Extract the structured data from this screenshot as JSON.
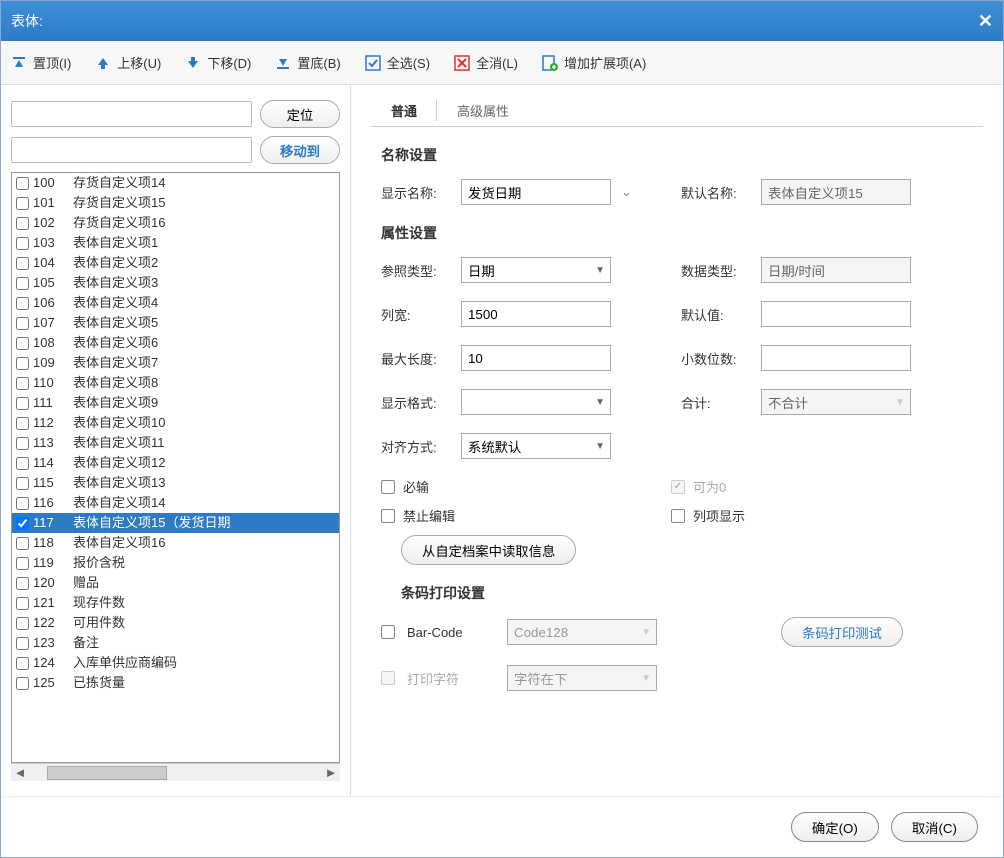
{
  "window": {
    "title": "表体:"
  },
  "toolbar": {
    "top_label": "置顶(I)",
    "up_label": "上移(U)",
    "down_label": "下移(D)",
    "bottom_label": "置底(B)",
    "selectall_label": "全选(S)",
    "clearall_label": "全消(L)",
    "addext_label": "增加扩展项(A)"
  },
  "left": {
    "locate_btn": "定位",
    "moveto_btn": "移动到",
    "items": [
      {
        "idx": "100",
        "label": "存货自定义项14",
        "checked": false,
        "selected": false
      },
      {
        "idx": "101",
        "label": "存货自定义项15",
        "checked": false,
        "selected": false
      },
      {
        "idx": "102",
        "label": "存货自定义项16",
        "checked": false,
        "selected": false
      },
      {
        "idx": "103",
        "label": "表体自定义项1",
        "checked": false,
        "selected": false
      },
      {
        "idx": "104",
        "label": "表体自定义项2",
        "checked": false,
        "selected": false
      },
      {
        "idx": "105",
        "label": "表体自定义项3",
        "checked": false,
        "selected": false
      },
      {
        "idx": "106",
        "label": "表体自定义项4",
        "checked": false,
        "selected": false
      },
      {
        "idx": "107",
        "label": "表体自定义项5",
        "checked": false,
        "selected": false
      },
      {
        "idx": "108",
        "label": "表体自定义项6",
        "checked": false,
        "selected": false
      },
      {
        "idx": "109",
        "label": "表体自定义项7",
        "checked": false,
        "selected": false
      },
      {
        "idx": "110",
        "label": "表体自定义项8",
        "checked": false,
        "selected": false
      },
      {
        "idx": "111",
        "label": "表体自定义项9",
        "checked": false,
        "selected": false
      },
      {
        "idx": "112",
        "label": "表体自定义项10",
        "checked": false,
        "selected": false
      },
      {
        "idx": "113",
        "label": "表体自定义项11",
        "checked": false,
        "selected": false
      },
      {
        "idx": "114",
        "label": "表体自定义项12",
        "checked": false,
        "selected": false
      },
      {
        "idx": "115",
        "label": "表体自定义项13",
        "checked": false,
        "selected": false
      },
      {
        "idx": "116",
        "label": "表体自定义项14",
        "checked": false,
        "selected": false
      },
      {
        "idx": "117",
        "label": "表体自定义项15（发货日期",
        "checked": true,
        "selected": true
      },
      {
        "idx": "118",
        "label": "表体自定义项16",
        "checked": false,
        "selected": false
      },
      {
        "idx": "119",
        "label": "报价含税",
        "checked": false,
        "selected": false
      },
      {
        "idx": "120",
        "label": "赠品",
        "checked": false,
        "selected": false
      },
      {
        "idx": "121",
        "label": "现存件数",
        "checked": false,
        "selected": false
      },
      {
        "idx": "122",
        "label": "可用件数",
        "checked": false,
        "selected": false
      },
      {
        "idx": "123",
        "label": "备注",
        "checked": false,
        "selected": false
      },
      {
        "idx": "124",
        "label": "入库单供应商编码",
        "checked": false,
        "selected": false
      },
      {
        "idx": "125",
        "label": "已拣货量",
        "checked": false,
        "selected": false
      }
    ]
  },
  "tabs": {
    "basic": "普通",
    "advanced": "高级属性"
  },
  "sections": {
    "name": "名称设置",
    "attr": "属性设置",
    "barcode": "条码打印设置"
  },
  "form": {
    "display_name_label": "显示名称:",
    "display_name_value": "发货日期",
    "default_name_label": "默认名称:",
    "default_name_value": "表体自定义项15",
    "ref_type_label": "参照类型:",
    "ref_type_value": "日期",
    "data_type_label": "数据类型:",
    "data_type_value": "日期/时间",
    "col_width_label": "列宽:",
    "col_width_value": "1500",
    "default_val_label": "默认值:",
    "default_val_value": "",
    "maxlen_label": "最大长度:",
    "maxlen_value": "10",
    "decimal_label": "小数位数:",
    "decimal_value": "",
    "format_label": "显示格式:",
    "format_value": "",
    "sum_label": "合计:",
    "sum_value": "不合计",
    "align_label": "对齐方式:",
    "align_value": "系统默认",
    "required_label": "必输",
    "nullable_label": "可为0",
    "readonly_label": "禁止编辑",
    "colshow_label": "列项显示",
    "readfromarchive_btn": "从自定档案中读取信息",
    "barcode_label": "Bar-Code",
    "barcode_value": "Code128",
    "printchar_label": "打印字符",
    "printchar_value": "字符在下",
    "barcode_test_btn": "条码打印测试"
  },
  "footer": {
    "ok": "确定(O)",
    "cancel": "取消(C)"
  }
}
